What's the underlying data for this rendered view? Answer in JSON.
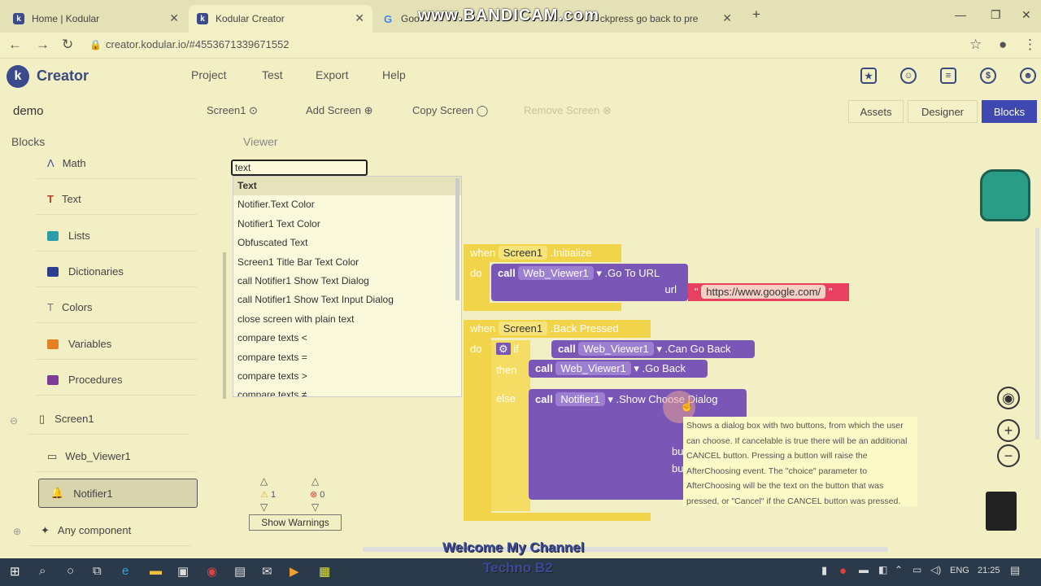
{
  "browser": {
    "tabs": [
      {
        "title": "Home | Kodular"
      },
      {
        "title": "Kodular Creator"
      },
      {
        "title": "Goo"
      },
      {
        "title": "ckpress go back to pre"
      }
    ],
    "url": "creator.kodular.io/#4553671339671552",
    "watermark": "www.BANDICAM.com",
    "new_tab": "+"
  },
  "app": {
    "brand": "Creator",
    "menu": [
      "Project",
      "Test",
      "Export",
      "Help"
    ]
  },
  "toolbar": {
    "project": "demo",
    "screen": "Screen1",
    "add_screen": "Add Screen",
    "copy_screen": "Copy Screen",
    "remove_screen": "Remove Screen",
    "assets": "Assets",
    "designer": "Designer",
    "blocks": "Blocks"
  },
  "headers": {
    "blocks": "Blocks",
    "viewer": "Viewer"
  },
  "sidebar": {
    "items": [
      "Math",
      "Text",
      "Lists",
      "Dictionaries",
      "Colors",
      "Variables",
      "Procedures",
      "Screen1",
      "Web_Viewer1",
      "Notifier1",
      "Any component"
    ]
  },
  "search": {
    "value": "text"
  },
  "dropdown": {
    "items": [
      "Text",
      "Notifier.Text Color",
      "Notifier1 Text Color",
      "Obfuscated Text",
      "Screen1 Title Bar Text Color",
      "call Notifier1 Show Text Dialog",
      "call Notifier1 Show Text Input Dialog",
      "close screen with plain text",
      "compare texts <",
      "compare texts =",
      "compare texts >",
      "compare texts ≠"
    ]
  },
  "blocks": {
    "when": "when",
    "do": "do",
    "screen1": "Screen1",
    "initialize": ".Initialize",
    "call": "call",
    "web_viewer": "Web_Viewer1",
    "go_to_url": ".Go To URL",
    "url": "url",
    "google_url": "https://www.google.com/",
    "back_pressed": ".Back Pressed",
    "if": "if",
    "then": "then",
    "else": "else",
    "can_go_back": ".Can Go Back",
    "go_back": ".Go Back",
    "notifier": "Notifier1",
    "show_choose": ".Show Choose Dialog",
    "bu": "bu"
  },
  "tooltip": "Shows a dialog box with two buttons, from which the user can choose. If cancelable is true there will be an additional CANCEL button. Pressing a button will raise the AfterChoosing event. The \"choice\" parameter to AfterChoosing will be the text on the button that was pressed, or \"Cancel\" if the CANCEL button was pressed.",
  "warnings": {
    "warn_count": "1",
    "error_count": "0",
    "show_warnings": "Show Warnings"
  },
  "footer": {
    "line1": "Welcome My Channel",
    "line2": "Techno B2"
  },
  "taskbar": {
    "lang": "ENG",
    "time": "21:25"
  }
}
